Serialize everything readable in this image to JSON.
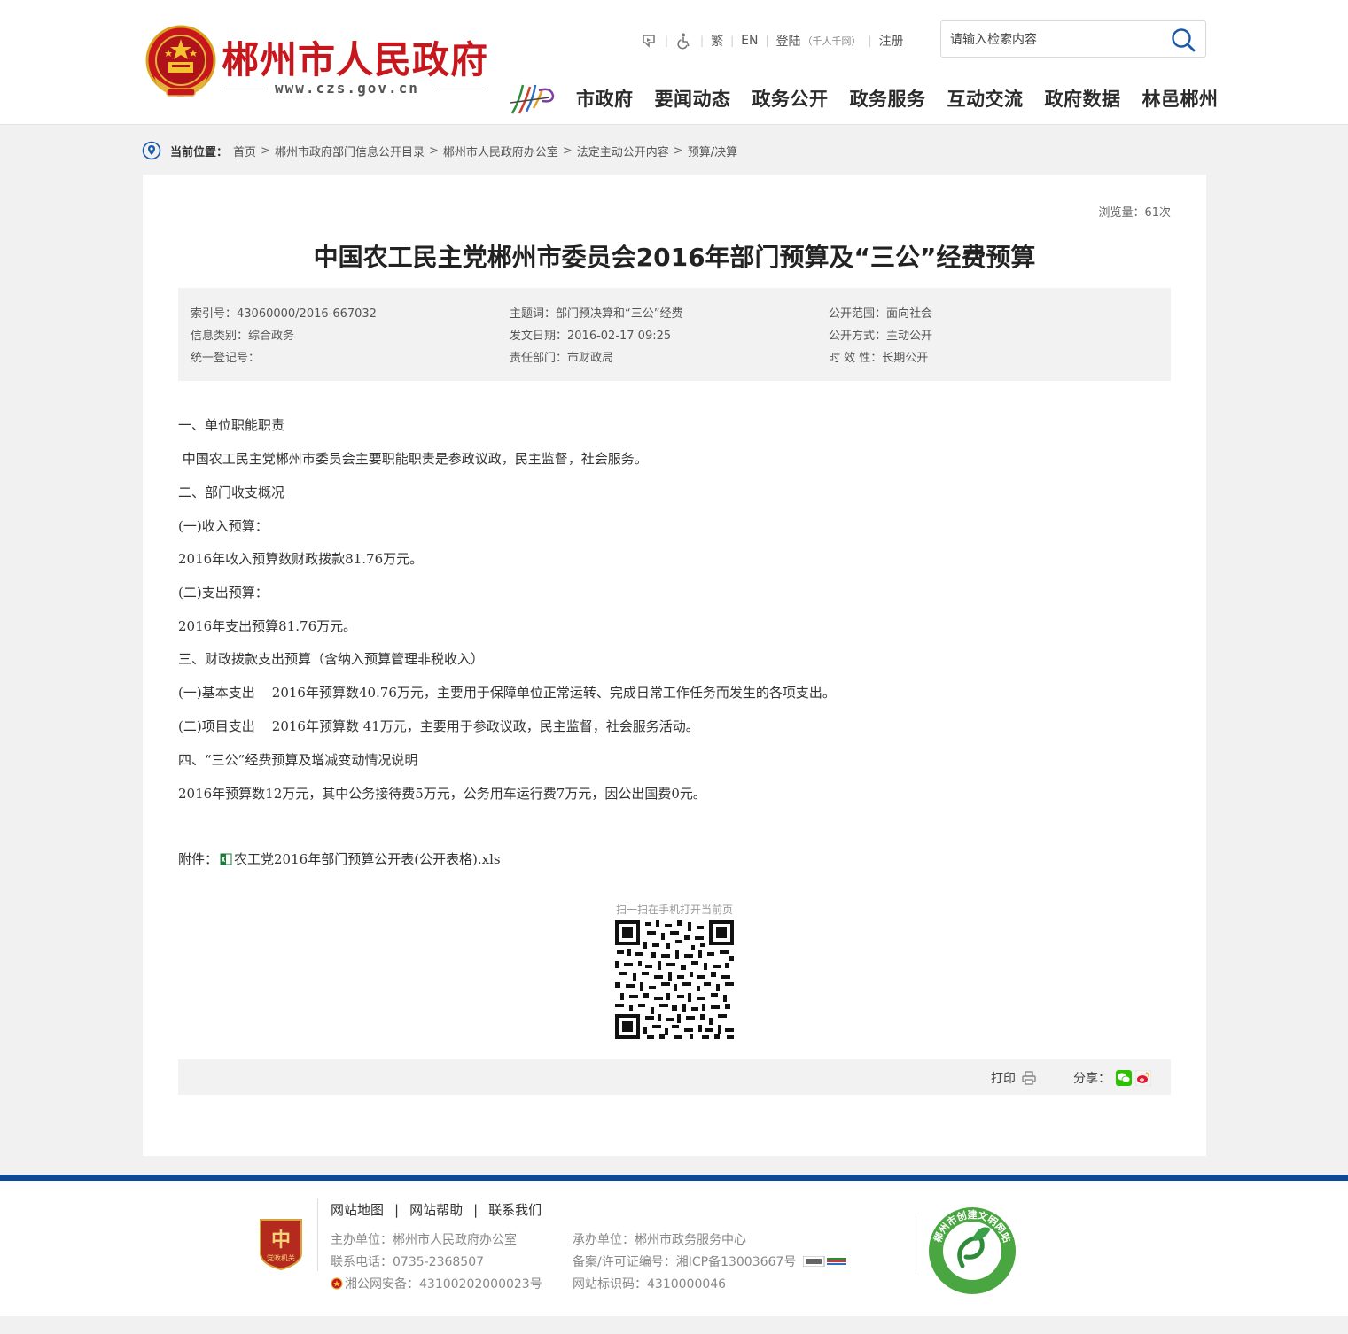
{
  "header": {
    "site_title": "郴州市人民政府",
    "site_domain": "www.czs.gov.cn",
    "top_links": {
      "traditional": "繁",
      "english": "EN",
      "login": "登陆",
      "login_note": "（千人千网）",
      "register": "注册"
    },
    "search_placeholder": "请输入检索内容",
    "nav": [
      "市政府",
      "要闻动态",
      "政务公开",
      "政务服务",
      "互动交流",
      "政府数据",
      "林邑郴州"
    ]
  },
  "breadcrumb": {
    "label": "当前位置：",
    "items": [
      "首页",
      "郴州市政府部门信息公开目录",
      "郴州市人民政府办公室",
      "法定主动公开内容",
      "预算/决算"
    ],
    "separator": ">"
  },
  "article": {
    "views": "浏览量：61次",
    "title": "中国农工民主党郴州市委员会2016年部门预算及“三公”经费预算",
    "meta": {
      "index_no": "索引号：43060000/2016-667032",
      "subject": "主题词：部门预决算和“三公”经费",
      "scope": "公开范围：面向社会",
      "category": "信息类别：综合政务",
      "date": "发文日期：2016-02-17 09:25",
      "method": "公开方式：主动公开",
      "reg_no": "统一登记号：",
      "dept": "责任部门：市财政局",
      "validity": "时 效 性：长期公开"
    },
    "paragraphs": [
      "一、单位职能职责",
      " 中国农工民主党郴州市委员会主要职能职责是参政议政，民主监督，社会服务。",
      "二、部门收支概况",
      "(一)收入预算：",
      "2016年收入预算数财政拨款81.76万元。",
      "(二)支出预算：",
      "2016年支出预算81.76万元。",
      "三、财政拨款支出预算（含纳入预算管理非税收入）",
      "(一)基本支出    2016年预算数40.76万元，主要用于保障单位正常运转、完成日常工作任务而发生的各项支出。",
      "(二)项目支出    2016年预算数 41万元，主要用于参政议政，民主监督，社会服务活动。",
      "四、“三公”经费预算及增减变动情况说明",
      "2016年预算数12万元，其中公务接待费5万元，公务用车运行费7万元，因公出国费0元。"
    ],
    "attachment_label": "附件：",
    "attachment_file": "农工党2016年部门预算公开表(公开表格).xls",
    "qr_caption": "扫一扫在手机打开当前页",
    "print_label": "打印",
    "share_label": "分享："
  },
  "footer": {
    "links": [
      "网站地图",
      "网站帮助",
      "联系我们"
    ],
    "host": "主办单位：郴州市人民政府办公室",
    "organizer": "承办单位：郴州市政务服务中心",
    "phone": "联系电话：0735-2368507",
    "icp": "备案/许可证编号：湘ICP备13003667号",
    "police": "湘公网安备：43100202000023号",
    "site_id": "网站标识码：4310000046",
    "badge_text": "党政机关",
    "seal_text": "郴州市创建文明网站"
  },
  "colors": {
    "brand_red": "#c8161d",
    "footer_blue": "#0d4a95",
    "search_icon": "#1a5aa8"
  }
}
